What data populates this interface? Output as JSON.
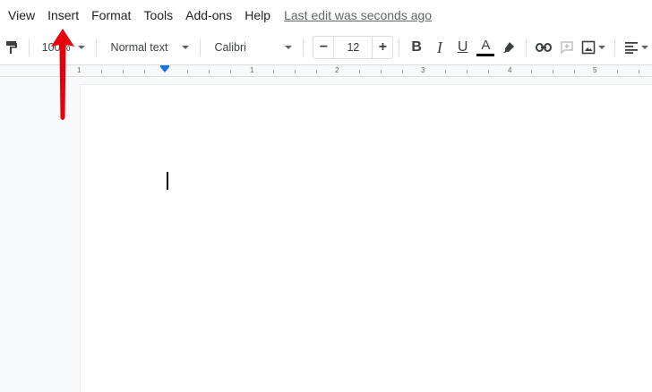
{
  "menubar": {
    "items": [
      "View",
      "Insert",
      "Format",
      "Tools",
      "Add-ons",
      "Help"
    ],
    "last_edit": "Last edit was seconds ago"
  },
  "toolbar": {
    "zoom": "100%",
    "style": "Normal text",
    "font": "Calibri",
    "font_size": "12",
    "decrease_label": "−",
    "increase_label": "+",
    "bold_label": "B",
    "italic_label": "I",
    "underline_label": "U",
    "text_color_label": "A",
    "text_color": "#000000"
  },
  "ruler": {
    "labels": [
      "1",
      "1",
      "2",
      "3",
      "4",
      "5"
    ]
  },
  "annotation": {
    "arrow_color": "#e8000b"
  }
}
